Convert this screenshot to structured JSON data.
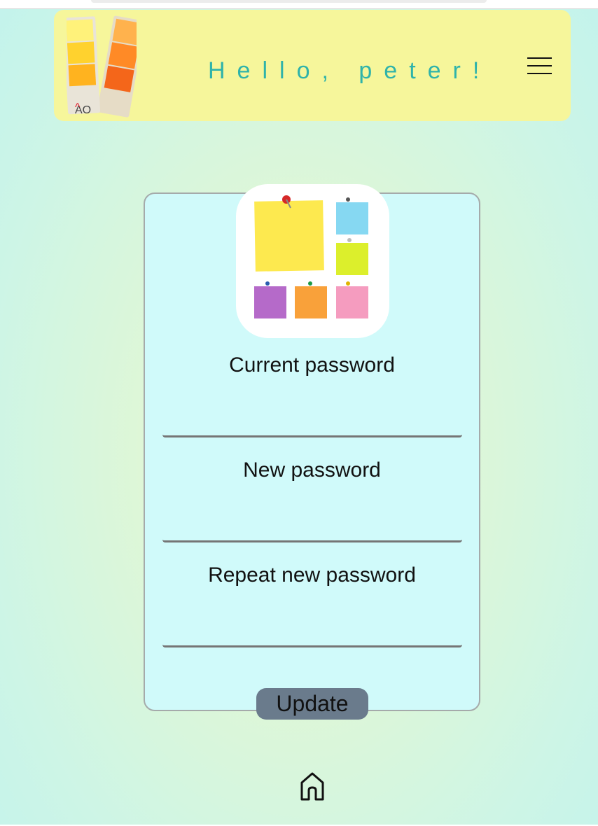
{
  "header": {
    "greeting": "Hello, peter!",
    "logo_icon": "color-swatch-fan-icon",
    "logo_letters": "AO",
    "menu_icon": "hamburger-menu-icon"
  },
  "form": {
    "image_icon": "sticky-notes-icon",
    "fields": [
      {
        "label": "Current password",
        "value": ""
      },
      {
        "label": "New password",
        "value": ""
      },
      {
        "label": "Repeat new password",
        "value": ""
      }
    ],
    "submit_label": "Update"
  },
  "footer": {
    "home_icon": "home-icon"
  },
  "colors": {
    "header_bg": "#f6f69b",
    "greeting": "#2fb3aa",
    "card_bg": "#d0fafa",
    "button_bg": "#6a7b8c"
  }
}
